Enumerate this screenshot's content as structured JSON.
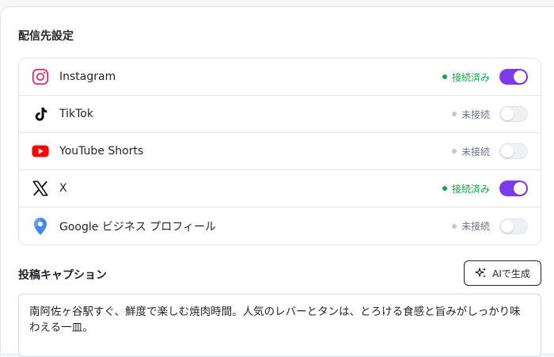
{
  "section_title": "配信先設定",
  "platforms": [
    {
      "name": "Instagram",
      "status": "接続済み",
      "connected": true,
      "icon": "instagram-icon"
    },
    {
      "name": "TikTok",
      "status": "未接続",
      "connected": false,
      "icon": "tiktok-icon"
    },
    {
      "name": "YouTube Shorts",
      "status": "未接続",
      "connected": false,
      "icon": "youtube-icon"
    },
    {
      "name": "X",
      "status": "接続済み",
      "connected": true,
      "icon": "x-icon"
    },
    {
      "name": "Google ビジネス プロフィール",
      "status": "未接続",
      "connected": false,
      "icon": "google-maps-pin-icon"
    }
  ],
  "caption": {
    "label": "投稿キャプション",
    "ai_button_label": "AIで生成",
    "text": "南阿佐ヶ谷駅すぐ、鮮度で楽しむ焼肉時間。人気のレバーとタンは、とろける食感と旨みがしっかり味わえる一皿。"
  },
  "colors": {
    "accent": "#7c3aed",
    "connected": "#16a34a",
    "disconnected": "#6b7280"
  }
}
